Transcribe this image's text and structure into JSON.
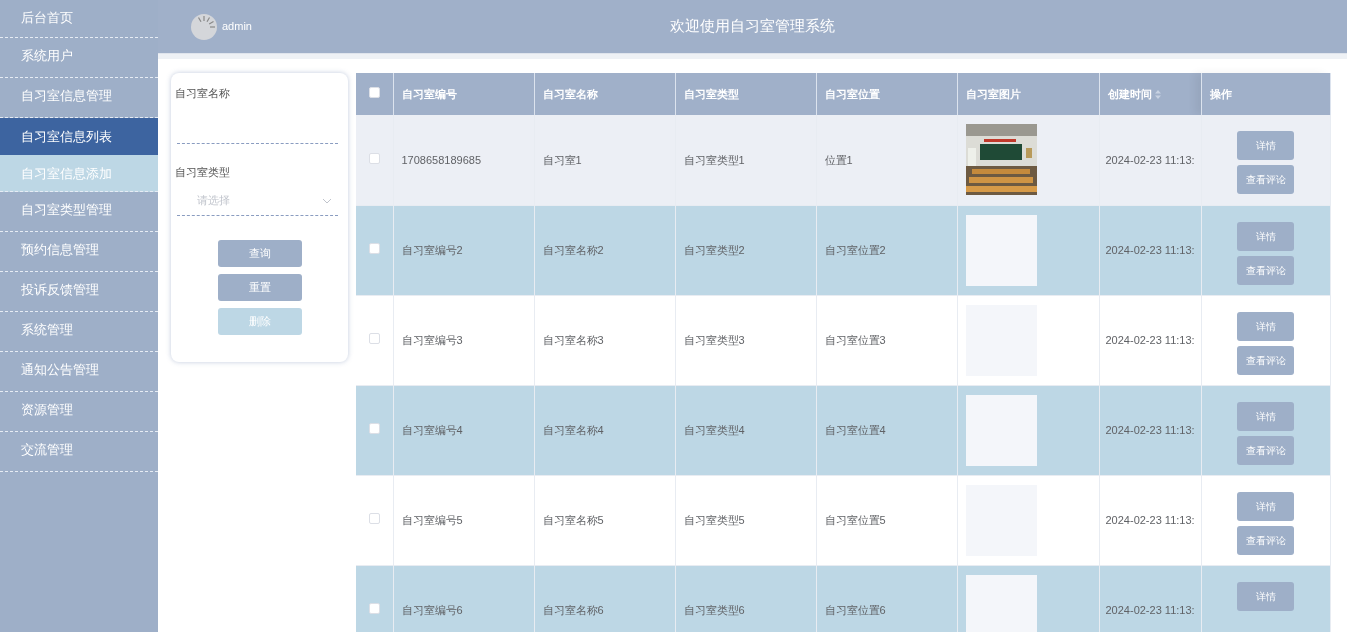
{
  "sidebar": {
    "items": [
      {
        "label": "后台首页",
        "selected": false
      },
      {
        "label": "系统用户",
        "selected": false
      },
      {
        "label": "自习室信息管理",
        "selected": false,
        "expanded": true,
        "children": [
          {
            "label": "自习室信息列表",
            "selected": true
          },
          {
            "label": "自习室信息添加",
            "selected": false
          }
        ]
      },
      {
        "label": "自习室类型管理",
        "selected": false
      },
      {
        "label": "预约信息管理",
        "selected": false
      },
      {
        "label": "投诉反馈管理",
        "selected": false
      },
      {
        "label": "系统管理",
        "selected": false
      },
      {
        "label": "通知公告管理",
        "selected": false
      },
      {
        "label": "资源管理",
        "selected": false
      },
      {
        "label": "交流管理",
        "selected": false
      }
    ]
  },
  "header": {
    "user": "admin",
    "title": "欢迎使用自习室管理系统"
  },
  "filter": {
    "fields": [
      {
        "kind": "text",
        "label": "自习室名称"
      },
      {
        "kind": "select",
        "label": "自习室类型",
        "placeholder": "请选择"
      }
    ],
    "buttons": [
      {
        "label": "查询",
        "disabled": false
      },
      {
        "label": "重置",
        "disabled": false
      },
      {
        "label": "删除",
        "disabled": true
      }
    ]
  },
  "table": {
    "select_all": {
      "checked": false
    },
    "columns": [
      {
        "label": "自习室编号"
      },
      {
        "label": "自习室名称"
      },
      {
        "label": "自习室类型"
      },
      {
        "label": "自习室位置"
      },
      {
        "label": "自习室图片"
      },
      {
        "label": "创建时间",
        "sortable": true
      },
      {
        "label": "操作"
      }
    ],
    "rows": [
      {
        "checked": false,
        "hovered": true,
        "cells": [
          "1708658189685",
          "自习室1",
          "自习室类型1",
          "位置1"
        ],
        "image": {
          "kind": "picture"
        },
        "created": "2024-02-23 11:13:",
        "actions": [
          "详情",
          "查看评论"
        ]
      },
      {
        "checked": false,
        "hovered": false,
        "cells": [
          "自习室编号2",
          "自习室名称2",
          "自习室类型2",
          "自习室位置2"
        ],
        "image": {
          "kind": "placeholder"
        },
        "created": "2024-02-23 11:13:",
        "actions": [
          "详情",
          "查看评论"
        ]
      },
      {
        "checked": false,
        "hovered": false,
        "cells": [
          "自习室编号3",
          "自习室名称3",
          "自习室类型3",
          "自习室位置3"
        ],
        "image": {
          "kind": "placeholder"
        },
        "created": "2024-02-23 11:13:",
        "actions": [
          "详情",
          "查看评论"
        ]
      },
      {
        "checked": false,
        "hovered": false,
        "cells": [
          "自习室编号4",
          "自习室名称4",
          "自习室类型4",
          "自习室位置4"
        ],
        "image": {
          "kind": "placeholder"
        },
        "created": "2024-02-23 11:13:",
        "actions": [
          "详情",
          "查看评论"
        ]
      },
      {
        "checked": false,
        "hovered": false,
        "cells": [
          "自习室编号5",
          "自习室名称5",
          "自习室类型5",
          "自习室位置5"
        ],
        "image": {
          "kind": "placeholder"
        },
        "created": "2024-02-23 11:13:",
        "actions": [
          "详情",
          "查看评论"
        ]
      },
      {
        "checked": false,
        "hovered": false,
        "cells": [
          "自习室编号6",
          "自习室名称6",
          "自习室类型6",
          "自习室位置6"
        ],
        "image": {
          "kind": "placeholder"
        },
        "created": "2024-02-23 11:13:",
        "actions": [
          "详情"
        ]
      }
    ]
  }
}
